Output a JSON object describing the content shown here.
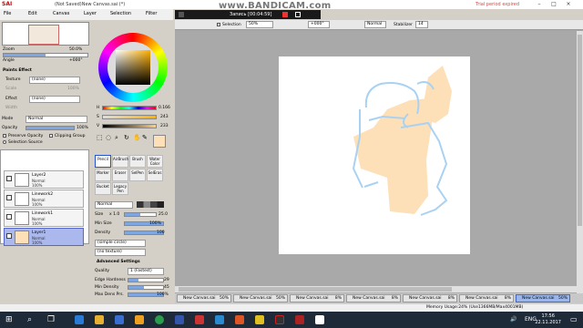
{
  "app": {
    "logo": "SAI",
    "document_title": "(Not Saved)New Canvas.sai (*)",
    "trial_notice": "Trial period expired"
  },
  "menu": [
    "File",
    "Edit",
    "Canvas",
    "Layer",
    "Selection",
    "Filter"
  ],
  "recorder": {
    "label": "Запись [00:04:59]",
    "watermark": "www.BANDICAM.com"
  },
  "canvas_toolbar": {
    "selection_label": "Selection",
    "zoom": "50%",
    "angle": "+000°",
    "blend_mode": "Normal",
    "stabilizer_label": "Stabilizer",
    "stabilizer_value": "14"
  },
  "navigator": {
    "zoom_label": "Zoom",
    "zoom_value": "50.0%",
    "angle_label": "Angle",
    "angle_value": "+000°"
  },
  "paint_effect": {
    "header": "Paints Effect",
    "texture_label": "Texture",
    "texture_value": "(none)",
    "scale_label": "Scale",
    "scale_value": "100%",
    "effect_label": "Effect",
    "effect_value": "(none)",
    "width_label": "Width",
    "intensity_label": "Intensity"
  },
  "layer_options": {
    "mode_label": "Mode",
    "mode_value": "Normal",
    "opacity_label": "Opacity",
    "opacity_value": "100%",
    "preserve_opacity": "Preserve Opacity",
    "clipping_group": "Clipping Group",
    "selection_source": "Selection Source"
  },
  "layers": [
    {
      "name": "Layer2",
      "mode": "Normal",
      "opacity": "100%",
      "selected": false
    },
    {
      "name": "Linework2",
      "mode": "Normal",
      "opacity": "100%",
      "selected": false
    },
    {
      "name": "Linework1",
      "mode": "Normal",
      "opacity": "100%",
      "selected": false
    },
    {
      "name": "Layer1",
      "mode": "Normal",
      "opacity": "100%",
      "selected": true
    }
  ],
  "color": {
    "h_label": "H",
    "h_value": "0.166",
    "s_label": "S",
    "s_value": "243",
    "v_label": "V",
    "v_value": "233",
    "current": "#fde0b8"
  },
  "tools": [
    {
      "label": "Pencil",
      "selected": true
    },
    {
      "label": "AirBrush",
      "selected": false
    },
    {
      "label": "Brush",
      "selected": false
    },
    {
      "label": "Water Color",
      "selected": false
    },
    {
      "label": "Marker",
      "selected": false
    },
    {
      "label": "Eraser",
      "selected": false
    },
    {
      "label": "SelPen",
      "selected": false
    },
    {
      "label": "SelEras",
      "selected": false
    },
    {
      "label": "Bucket",
      "selected": false
    },
    {
      "label": "Legacy Pen",
      "selected": false
    }
  ],
  "brush": {
    "mode_value": "Normal",
    "size_label": "Size",
    "size_mult": "x 1.0",
    "size_value": "25.0",
    "min_size_label": "Min Size",
    "min_size_value": "100%",
    "density_label": "Density",
    "density_value": "100",
    "shape_value": "(simple circle)",
    "texture_value": "(no texture)",
    "advanced_header": "Advanced Settings",
    "quality_label": "Quality",
    "quality_value": "1 (Fastest)",
    "edge_hardness_label": "Edge Hardness",
    "edge_hardness_value": "29",
    "min_density_label": "Min Density",
    "min_density_value": "45",
    "max_dens_prs_label": "Max Dens Prs.",
    "max_dens_prs_value": "100%"
  },
  "doc_tabs": [
    {
      "name": "New Canvas.sai",
      "zoom": "50%"
    },
    {
      "name": "New Canvas.sai",
      "zoom": "50%"
    },
    {
      "name": "New Canvas.sai",
      "zoom": "8%"
    },
    {
      "name": "New Canvas.sai",
      "zoom": "8%"
    },
    {
      "name": "New Canvas.sai",
      "zoom": "8%"
    },
    {
      "name": "New Canvas.sai",
      "zoom": "8%"
    },
    {
      "name": "New Canvas.sai",
      "zoom": "50%"
    }
  ],
  "status": {
    "memory": "Memory Usage:24% (Use1366MB/Max4001MB)"
  },
  "taskbar": {
    "time": "17:56",
    "date": "22.11.2017"
  },
  "colors": {
    "sketch_fill": "#fde0b8",
    "sketch_line": "#a9d2f2",
    "selected_layer": "#aab8ee"
  }
}
